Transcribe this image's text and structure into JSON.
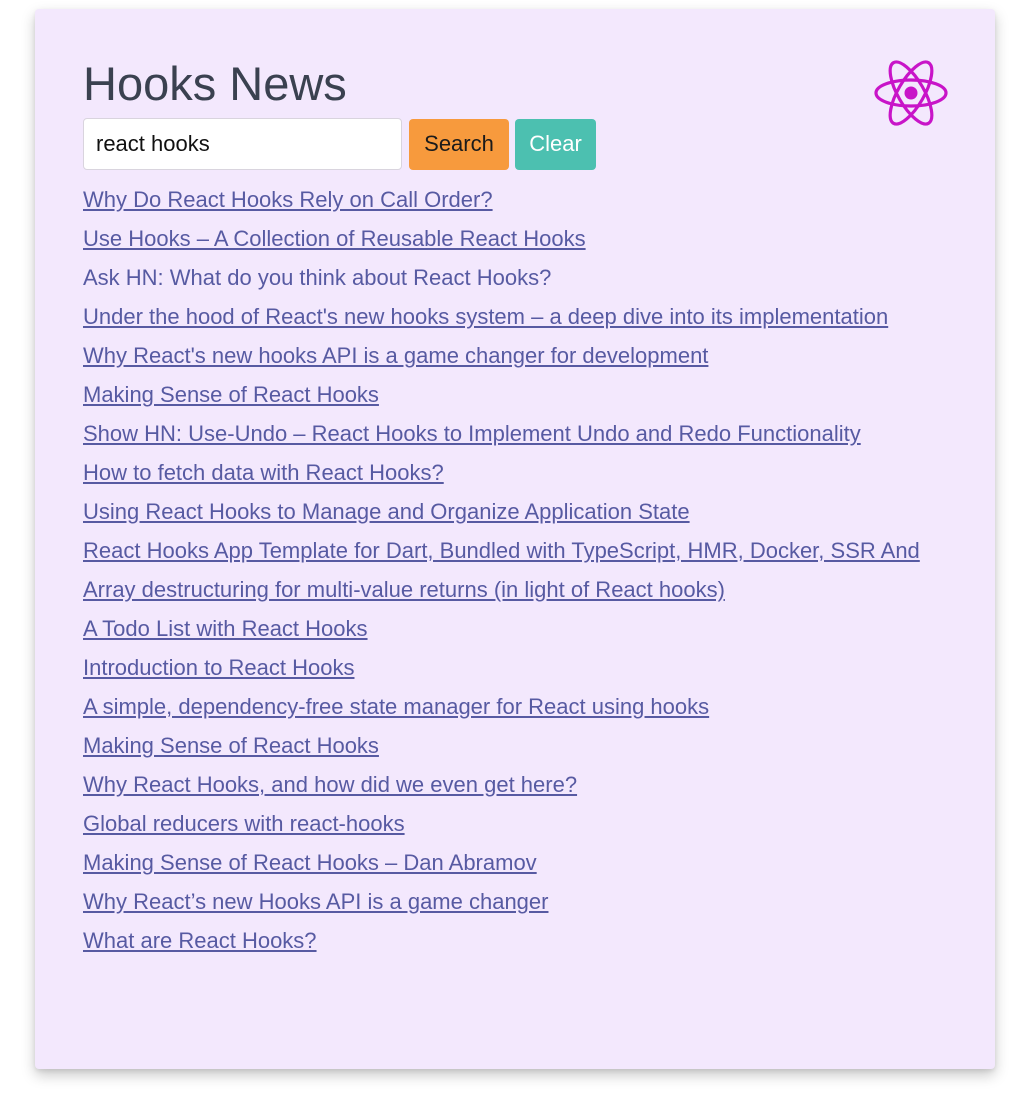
{
  "app": {
    "title": "Hooks News",
    "logo_icon": "react-atom-icon",
    "accent_color": "#c814c8"
  },
  "search": {
    "value": "react hooks",
    "placeholder": "",
    "search_label": "Search",
    "clear_label": "Clear",
    "search_color": "#f79a3d",
    "clear_color": "#4cc0b0"
  },
  "results": [
    {
      "title": "Why Do React Hooks Rely on Call Order?",
      "underlined": true
    },
    {
      "title": "Use Hooks – A Collection of Reusable React Hooks",
      "underlined": true
    },
    {
      "title": "Ask HN: What do you think about React Hooks?",
      "underlined": false
    },
    {
      "title": "Under the hood of React's new hooks system – a deep dive into its implementation",
      "underlined": true
    },
    {
      "title": "Why React's new hooks API is a game changer for development",
      "underlined": true
    },
    {
      "title": "Making Sense of React Hooks",
      "underlined": true
    },
    {
      "title": "Show HN: Use-Undo – React Hooks to Implement Undo and Redo Functionality",
      "underlined": true
    },
    {
      "title": "How to fetch data with React Hooks?",
      "underlined": true
    },
    {
      "title": "Using React Hooks to Manage and Organize Application State",
      "underlined": true
    },
    {
      "title": "React Hooks App Template for Dart, Bundled with TypeScript, HMR, Docker, SSR And",
      "underlined": true
    },
    {
      "title": "Array destructuring for multi-value returns (in light of React hooks)",
      "underlined": true
    },
    {
      "title": "A Todo List with React Hooks",
      "underlined": true
    },
    {
      "title": "Introduction to React Hooks",
      "underlined": true
    },
    {
      "title": "A simple, dependency-free state manager for React using hooks",
      "underlined": true
    },
    {
      "title": "Making Sense of React Hooks",
      "underlined": true
    },
    {
      "title": "Why React Hooks, and how did we even get here?",
      "underlined": true
    },
    {
      "title": "Global reducers with react-hooks",
      "underlined": true
    },
    {
      "title": "Making Sense of React Hooks – Dan Abramov",
      "underlined": true
    },
    {
      "title": "Why React’s new Hooks API is a game changer",
      "underlined": true
    },
    {
      "title": "What are React Hooks?",
      "underlined": true
    }
  ]
}
